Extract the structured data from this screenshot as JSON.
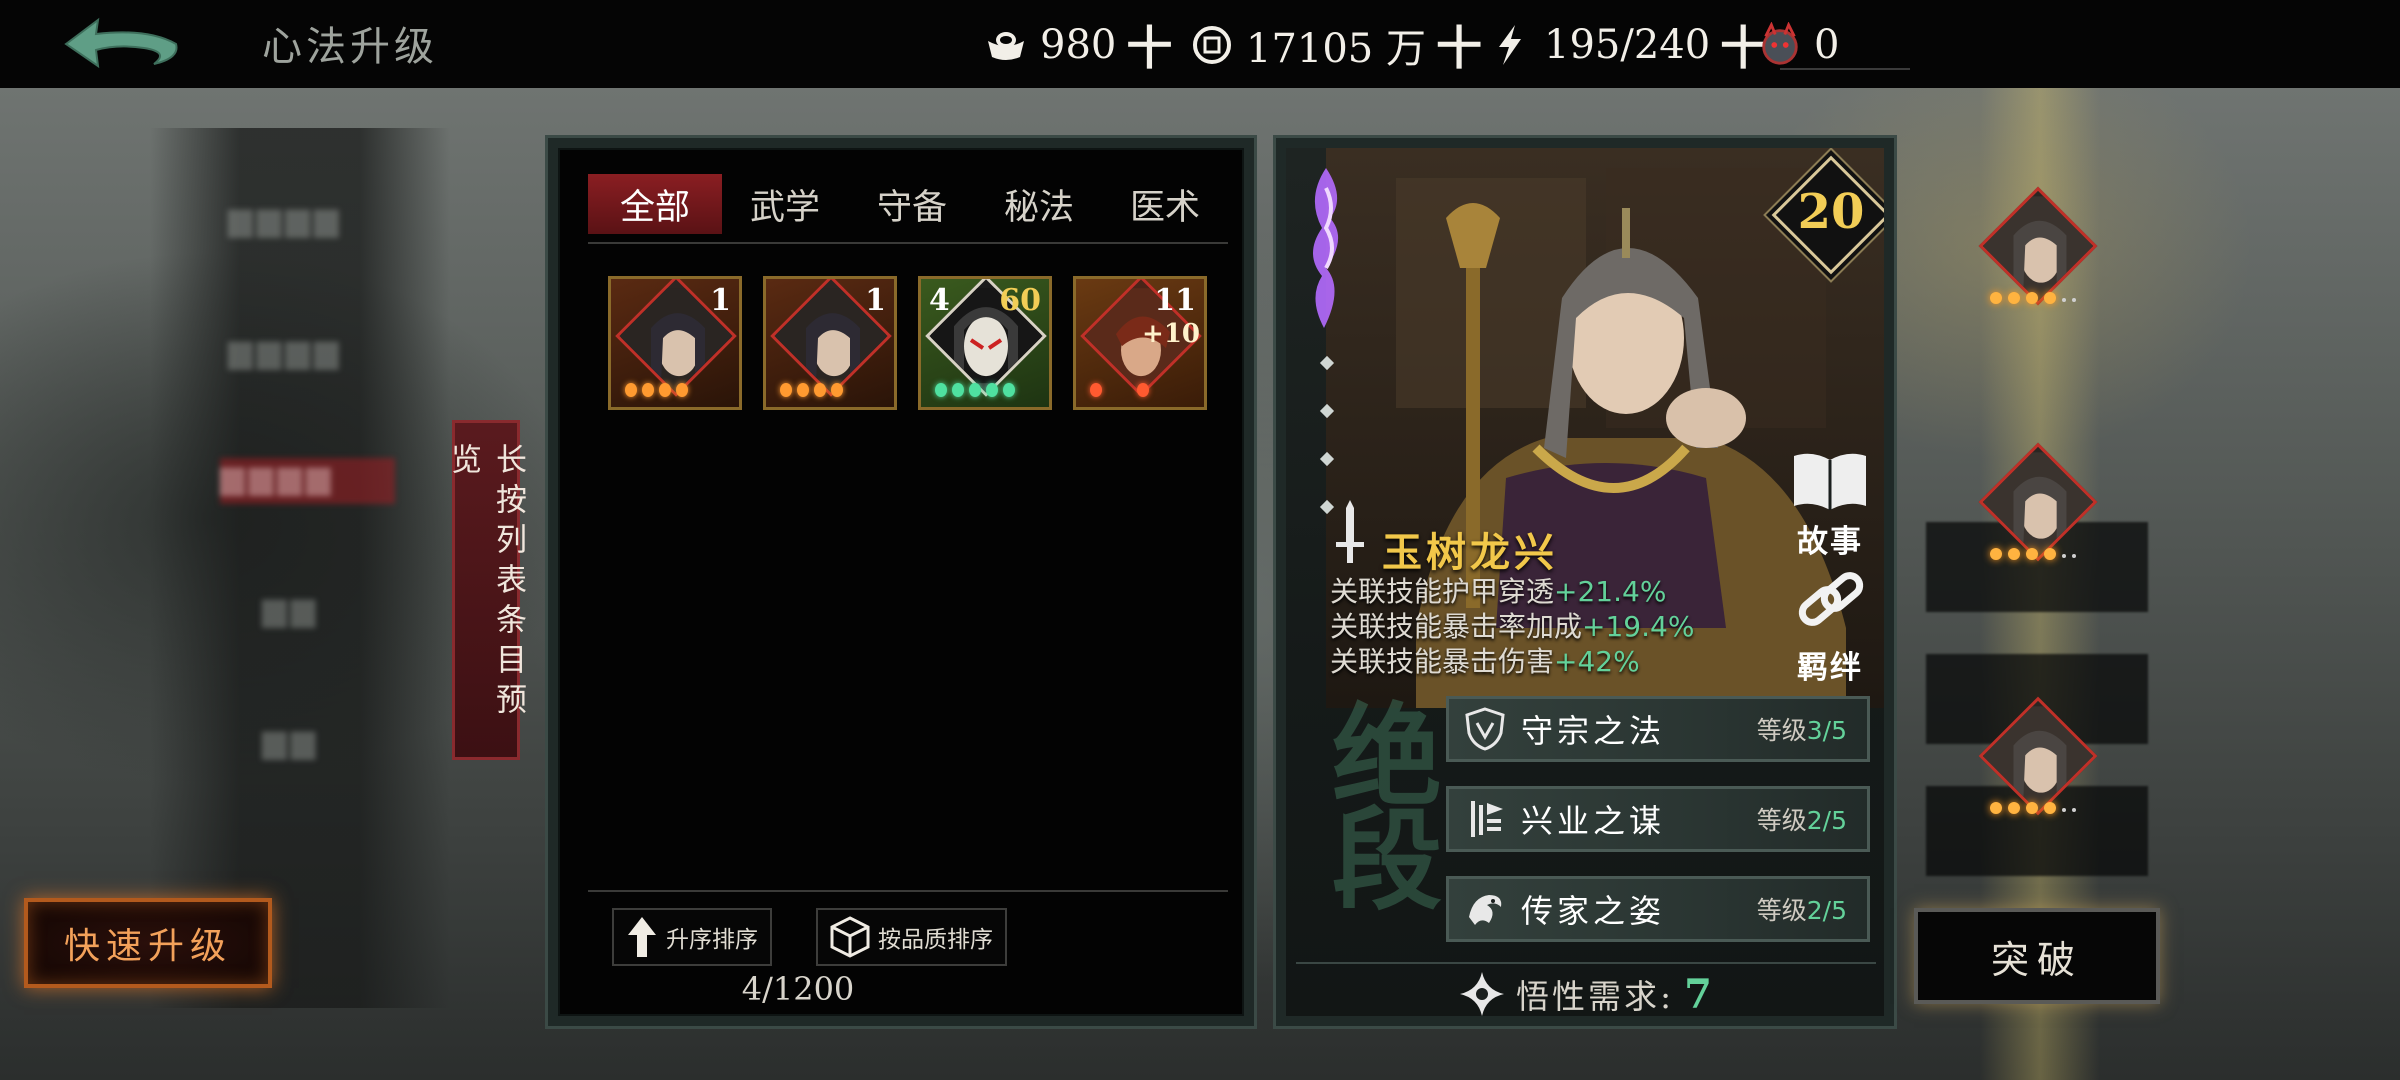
{
  "header": {
    "title": "心法升级",
    "silver": "980",
    "coins": "17105 万",
    "stamina": "195/240",
    "tokens": "0",
    "plus": "十"
  },
  "left_menu": {
    "hint": "长按列表条目预览",
    "quick_upgrade": "快速升级"
  },
  "list": {
    "tabs": [
      "全部",
      "武学",
      "守备",
      "秘法",
      "医术"
    ],
    "active_tab": 0,
    "cards": [
      {
        "top_right": "1",
        "top_left": "",
        "plus": "",
        "stars": 4,
        "star_color": "#ff9a30"
      },
      {
        "top_right": "1",
        "top_left": "",
        "plus": "",
        "stars": 4,
        "star_color": "#ff9a30"
      },
      {
        "top_right": "60",
        "top_left": "4",
        "plus": "",
        "stars": 5,
        "star_color": "#4fe0a0"
      },
      {
        "top_right": "11",
        "top_left": "",
        "plus": "+10",
        "stars": 2,
        "star_color": "#ff5a30"
      }
    ],
    "sort_ascending": "升序排序",
    "sort_quality": "按品质排序",
    "count": "4/1200"
  },
  "detail": {
    "level": "20",
    "story": "故事",
    "bond": "羁绊",
    "name": "玉树龙兴",
    "stats": [
      {
        "label": "关联技能护甲穿透",
        "value": "+21.4%"
      },
      {
        "label": "关联技能暴击率加成",
        "value": "+19.4%"
      },
      {
        "label": "关联技能暴击伤害",
        "value": "+42%"
      }
    ],
    "watermark": "绝段",
    "abilities": [
      {
        "name": "守宗之法",
        "level_label": "等级",
        "level": "3/5"
      },
      {
        "name": "兴业之谋",
        "level_label": "等级",
        "level": "2/5"
      },
      {
        "name": "传家之姿",
        "level_label": "等级",
        "level": "2/5"
      }
    ],
    "wisdom_label": "悟性需求:",
    "wisdom_value": "7"
  },
  "right": {
    "breakthrough": "突破"
  }
}
